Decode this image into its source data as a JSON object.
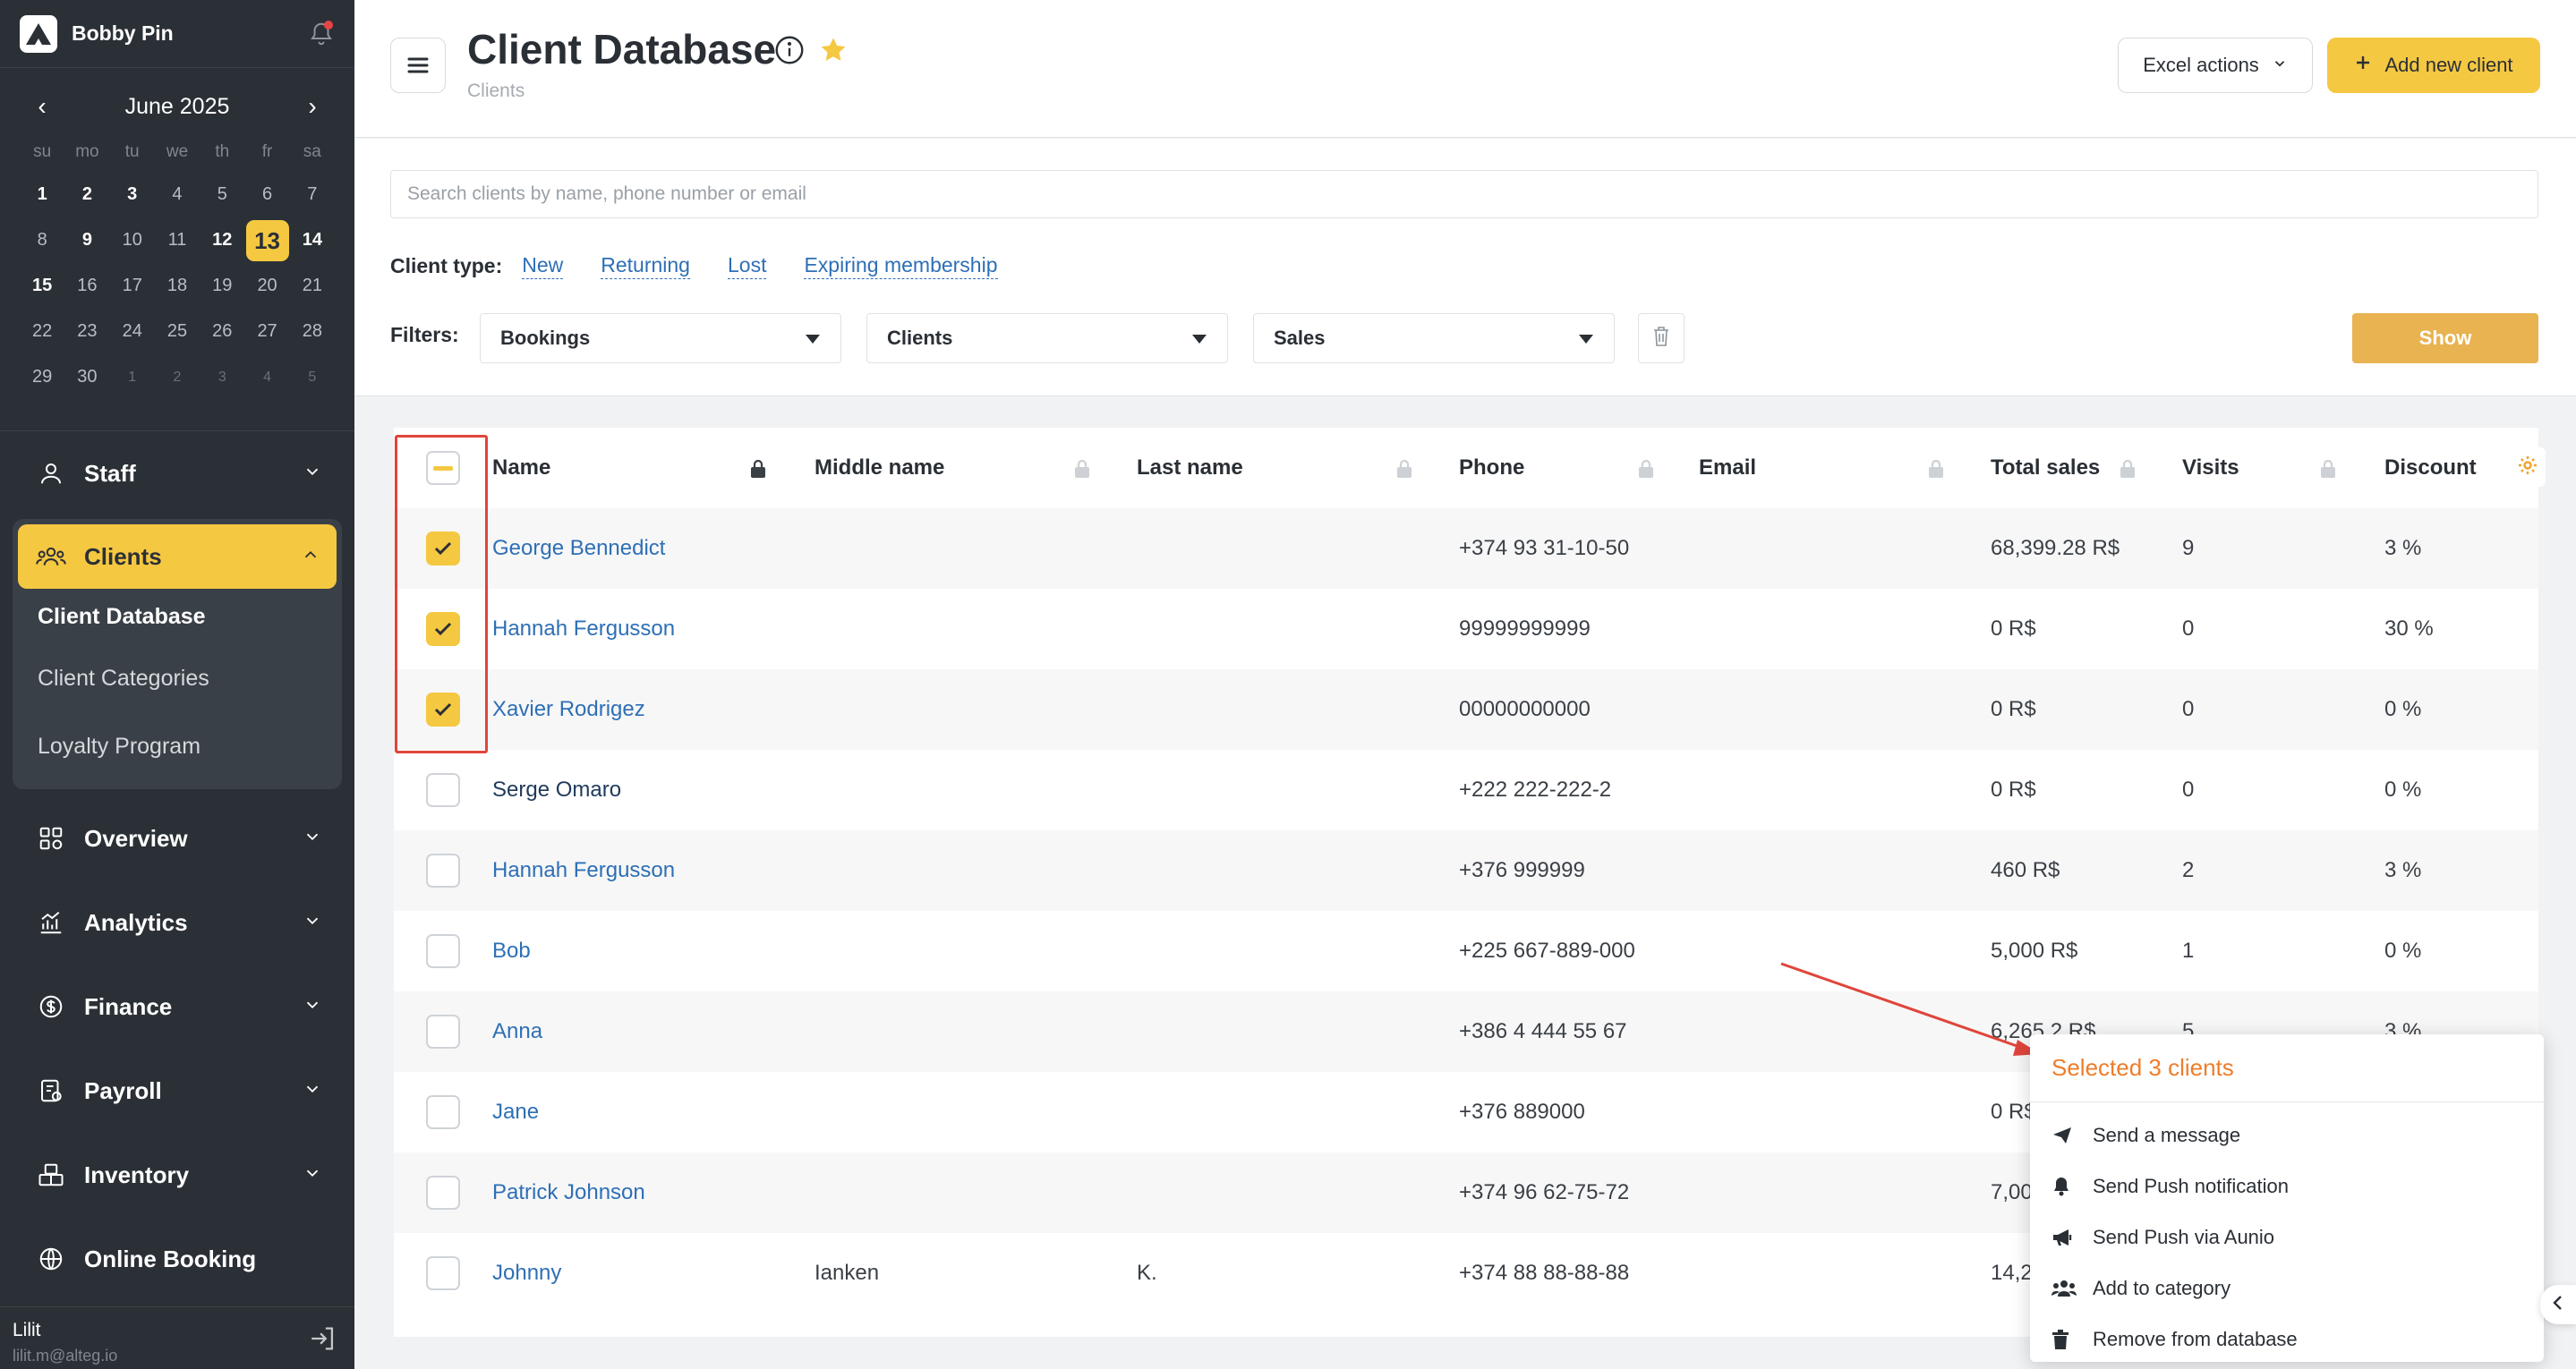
{
  "brand": {
    "name": "Bobby Pin"
  },
  "calendar": {
    "title": "June 2025",
    "dow": [
      "su",
      "mo",
      "tu",
      "we",
      "th",
      "fr",
      "sa"
    ],
    "days": [
      {
        "d": "1",
        "s": "bold"
      },
      {
        "d": "2",
        "s": "bold"
      },
      {
        "d": "3",
        "s": "bold"
      },
      {
        "d": "4",
        "s": ""
      },
      {
        "d": "5",
        "s": ""
      },
      {
        "d": "6",
        "s": ""
      },
      {
        "d": "7",
        "s": ""
      },
      {
        "d": "8",
        "s": ""
      },
      {
        "d": "9",
        "s": "bold"
      },
      {
        "d": "10",
        "s": ""
      },
      {
        "d": "11",
        "s": ""
      },
      {
        "d": "12",
        "s": "bold"
      },
      {
        "d": "13",
        "s": "today"
      },
      {
        "d": "14",
        "s": "bold"
      },
      {
        "d": "15",
        "s": "bold"
      },
      {
        "d": "16",
        "s": ""
      },
      {
        "d": "17",
        "s": ""
      },
      {
        "d": "18",
        "s": ""
      },
      {
        "d": "19",
        "s": ""
      },
      {
        "d": "20",
        "s": ""
      },
      {
        "d": "21",
        "s": ""
      },
      {
        "d": "22",
        "s": ""
      },
      {
        "d": "23",
        "s": ""
      },
      {
        "d": "24",
        "s": ""
      },
      {
        "d": "25",
        "s": ""
      },
      {
        "d": "26",
        "s": ""
      },
      {
        "d": "27",
        "s": ""
      },
      {
        "d": "28",
        "s": ""
      },
      {
        "d": "29",
        "s": ""
      },
      {
        "d": "30",
        "s": ""
      },
      {
        "d": "1",
        "s": "muted"
      },
      {
        "d": "2",
        "s": "muted"
      },
      {
        "d": "3",
        "s": "muted"
      },
      {
        "d": "4",
        "s": "muted"
      },
      {
        "d": "5",
        "s": "muted"
      }
    ]
  },
  "nav": {
    "staff": "Staff",
    "clients": "Clients",
    "clients_sub": [
      "Client Database",
      "Client Categories",
      "Loyalty Program"
    ],
    "overview": "Overview",
    "analytics": "Analytics",
    "finance": "Finance",
    "payroll": "Payroll",
    "inventory": "Inventory",
    "online_booking": "Online Booking"
  },
  "user": {
    "name": "Lilit",
    "email": "lilit.m@alteg.io"
  },
  "header": {
    "title": "Client Database",
    "breadcrumb": "Clients",
    "excel_label": "Excel actions",
    "add_label": "Add new client"
  },
  "filters": {
    "search_placeholder": "Search clients by name, phone number or email",
    "client_type_label": "Client type:",
    "client_types": [
      "New",
      "Returning",
      "Lost",
      "Expiring membership"
    ],
    "filters_label": "Filters:",
    "selects": [
      "Bookings",
      "Clients",
      "Sales"
    ],
    "show_label": "Show"
  },
  "table": {
    "columns": [
      "Name",
      "Middle name",
      "Last name",
      "Phone",
      "Email",
      "Total sales",
      "Visits",
      "Discount"
    ],
    "rows": [
      {
        "checked": true,
        "name": "George Bennedict",
        "middle": "",
        "last": "",
        "phone": "+374 93 31-10-50",
        "email": "",
        "sales": "68,399.28 R$",
        "visits": "9",
        "discount": "3 %"
      },
      {
        "checked": true,
        "name": "Hannah Fergusson",
        "middle": "",
        "last": "",
        "phone": "99999999999",
        "email": "",
        "sales": "0 R$",
        "visits": "0",
        "discount": "30 %"
      },
      {
        "checked": true,
        "name": "Xavier Rodrigez",
        "middle": "",
        "last": "",
        "phone": "00000000000",
        "email": "",
        "sales": "0 R$",
        "visits": "0",
        "discount": "0 %"
      },
      {
        "checked": false,
        "name": "Serge Omaro",
        "middle": "",
        "last": "",
        "phone": "+222 222-222-2",
        "email": "",
        "sales": "0 R$",
        "visits": "0",
        "discount": "0 %"
      },
      {
        "checked": false,
        "name": "Hannah Fergusson",
        "middle": "",
        "last": "",
        "phone": "+376 999999",
        "email": "",
        "sales": "460 R$",
        "visits": "2",
        "discount": "3 %"
      },
      {
        "checked": false,
        "name": "Bob",
        "middle": "",
        "last": "",
        "phone": "+225 667-889-000",
        "email": "",
        "sales": "5,000 R$",
        "visits": "1",
        "discount": "0 %"
      },
      {
        "checked": false,
        "name": "Anna",
        "middle": "",
        "last": "",
        "phone": "+386 4 444 55 67",
        "email": "",
        "sales": "6,265.2 R$",
        "visits": "5",
        "discount": "3 %"
      },
      {
        "checked": false,
        "name": "Jane",
        "middle": "",
        "last": "",
        "phone": "+376 889000",
        "email": "",
        "sales": "0 R$",
        "visits": "",
        "discount": ""
      },
      {
        "checked": false,
        "name": "Patrick Johnson",
        "middle": "",
        "last": "",
        "phone": "+374 96 62-75-72",
        "email": "",
        "sales": "7,00",
        "visits": "",
        "discount": ""
      },
      {
        "checked": false,
        "name": "Johnny",
        "middle": "Ianken",
        "last": "K.",
        "phone": "+374 88 88-88-88",
        "email": "",
        "sales": "14,2",
        "visits": "",
        "discount": ""
      }
    ]
  },
  "popup": {
    "title": "Selected 3 clients",
    "items": [
      {
        "icon": "send-icon",
        "label": "Send a message"
      },
      {
        "icon": "bell-icon",
        "label": "Send Push notification"
      },
      {
        "icon": "megaphone-icon",
        "label": "Send Push via Aunio"
      },
      {
        "icon": "users-icon",
        "label": "Add to category"
      },
      {
        "icon": "trash-icon",
        "label": "Remove from database"
      }
    ]
  },
  "colors": {
    "accent": "#f5c842",
    "sidebar": "#2b3036",
    "link": "#2e6fb5",
    "popup_title": "#ee7d2a",
    "annotation": "#e0453a"
  }
}
